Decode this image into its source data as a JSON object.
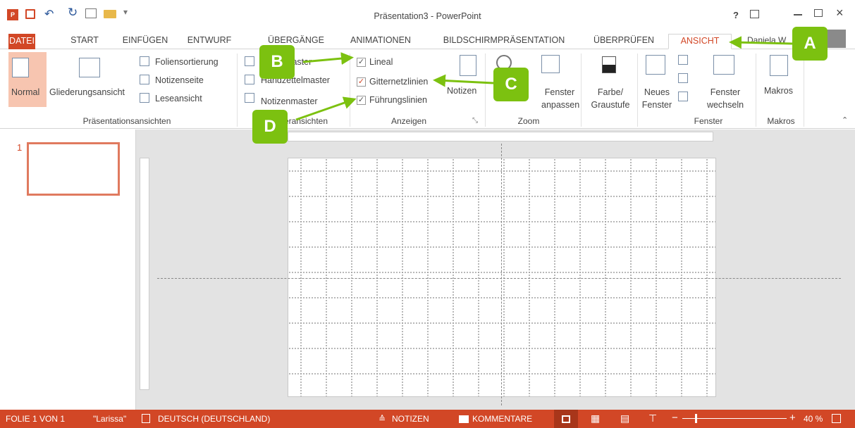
{
  "window": {
    "title": "Präsentation3 - PowerPoint",
    "help": "?",
    "user": "Daniela W"
  },
  "tabs": [
    "DATEI",
    "START",
    "EINFÜGEN",
    "ENTWURF",
    "ÜBERGÄNGE",
    "ANIMATIONEN",
    "BILDSCHIRMPRÄSENTATION",
    "ÜBERPRÜFEN",
    "ANSICHT"
  ],
  "ribbon": {
    "pres_views": {
      "normal": "Normal",
      "outline": "Gliederungsansicht",
      "sorter": "Foliensortierung",
      "notes_page": "Notizenseite",
      "reading": "Leseansicht",
      "label": "Präsentationsansichten"
    },
    "master_views": {
      "slide_master": "Folienmaster",
      "handout_master": "Handzettelmaster",
      "notes_master": "Notizenmaster",
      "label": "Masteransichten"
    },
    "show": {
      "ruler": "Lineal",
      "gridlines": "Gitternetzlinien",
      "guides": "Führungslinien",
      "notes": "Notizen",
      "label": "Anzeigen"
    },
    "zoom": {
      "fit": "Fenster anpassen",
      "label": "Zoom"
    },
    "color": {
      "label": "Farbe/ Graustufe"
    },
    "window": {
      "new": "Neues Fenster",
      "switch": "Fenster wechseln",
      "label": "Fenster"
    },
    "macros": {
      "macros": "Makros",
      "label": "Makros"
    }
  },
  "callouts": [
    "A",
    "B",
    "C",
    "D"
  ],
  "thumbnail": {
    "number": "1"
  },
  "status": {
    "slide": "FOLIE 1 VON 1",
    "theme": "\"Larissa\"",
    "language": "DEUTSCH (DEUTSCHLAND)",
    "notes": "NOTIZEN",
    "comments": "KOMMENTARE",
    "zoom": "40 %"
  }
}
